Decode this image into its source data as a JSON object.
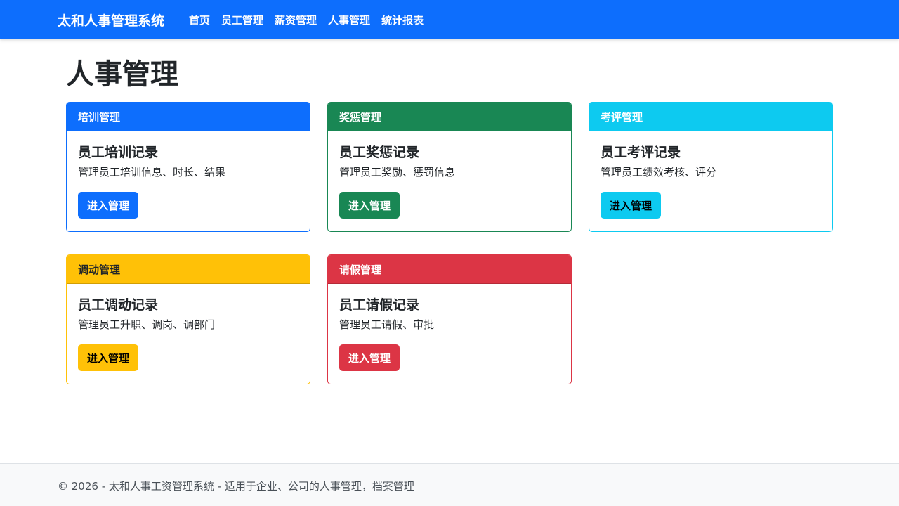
{
  "navbar": {
    "brand": "太和人事管理系统",
    "links": [
      "首页",
      "员工管理",
      "薪资管理",
      "人事管理",
      "统计报表"
    ]
  },
  "page_title": "人事管理",
  "cards": [
    {
      "header": "培训管理",
      "title": "员工培训记录",
      "text": "管理员工培训信息、时长、结果",
      "button": "进入管理",
      "color": "#0d6efd"
    },
    {
      "header": "奖惩管理",
      "title": "员工奖惩记录",
      "text": "管理员工奖励、惩罚信息",
      "button": "进入管理",
      "color": "#198754"
    },
    {
      "header": "考评管理",
      "title": "员工考评记录",
      "text": "管理员工绩效考核、评分",
      "button": "进入管理",
      "color": "#0dcaf0"
    },
    {
      "header": "调动管理",
      "title": "员工调动记录",
      "text": "管理员工升职、调岗、调部门",
      "button": "进入管理",
      "color": "#ffc107"
    },
    {
      "header": "请假管理",
      "title": "员工请假记录",
      "text": "管理员工请假、审批",
      "button": "进入管理",
      "color": "#dc3545"
    }
  ],
  "footer": {
    "text": "© 2026 - 太和人事工资管理系统 - 适用于企业、公司的人事管理，档案管理"
  }
}
